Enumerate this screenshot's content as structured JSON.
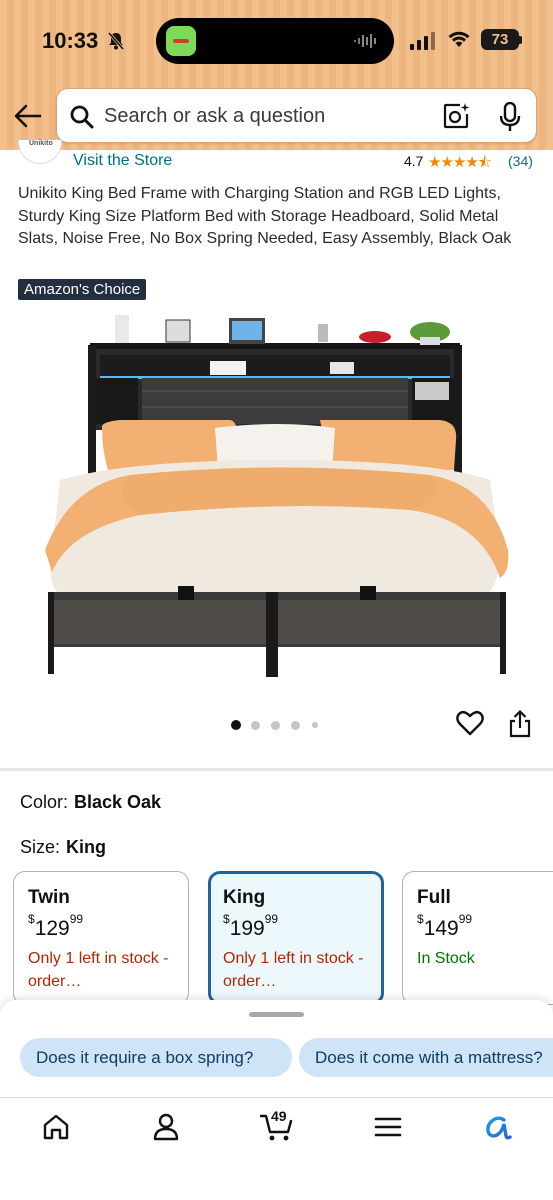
{
  "status_bar": {
    "time": "10:33",
    "battery": "73"
  },
  "search": {
    "placeholder": "Search or ask a question"
  },
  "store": {
    "link": "Visit the Store",
    "logo_text": "Unikito",
    "rating": "4.7",
    "rating_count": "(34)",
    "stars": "★★★★⯪"
  },
  "product": {
    "title": "Unikito King Bed Frame with Charging Station and RGB LED Lights, Sturdy King Size Platform Bed with Storage Headboard, Solid Metal Slats, Noise Free, No Box Spring Needed, Easy Assembly, Black Oak",
    "badge": "Amazon's Choice",
    "image_count": 5,
    "active_image": 1
  },
  "options": {
    "color_label": "Color:",
    "color_value": "Black Oak",
    "size_label": "Size:",
    "size_value": "King"
  },
  "sizes": [
    {
      "name": "Twin",
      "currency": "$",
      "dollars": "129",
      "cents": "99",
      "stock": "Only 1 left in stock - order…",
      "selected": false
    },
    {
      "name": "King",
      "currency": "$",
      "dollars": "199",
      "cents": "99",
      "stock": "Only 1 left in stock - order…",
      "selected": true
    },
    {
      "name": "Full",
      "currency": "$",
      "dollars": "149",
      "cents": "99",
      "stock": "In Stock",
      "selected": false
    }
  ],
  "questions": [
    "Does it require a box spring?",
    "Does it come with a mattress?"
  ],
  "nav": {
    "cart_count": "49"
  },
  "colors": {
    "header_bg": "#f2c08c",
    "link": "#007185",
    "selected_border": "#2162a1",
    "low_stock": "#b12704",
    "in_stock": "#007600",
    "chip_bg": "#cfe4f7"
  }
}
